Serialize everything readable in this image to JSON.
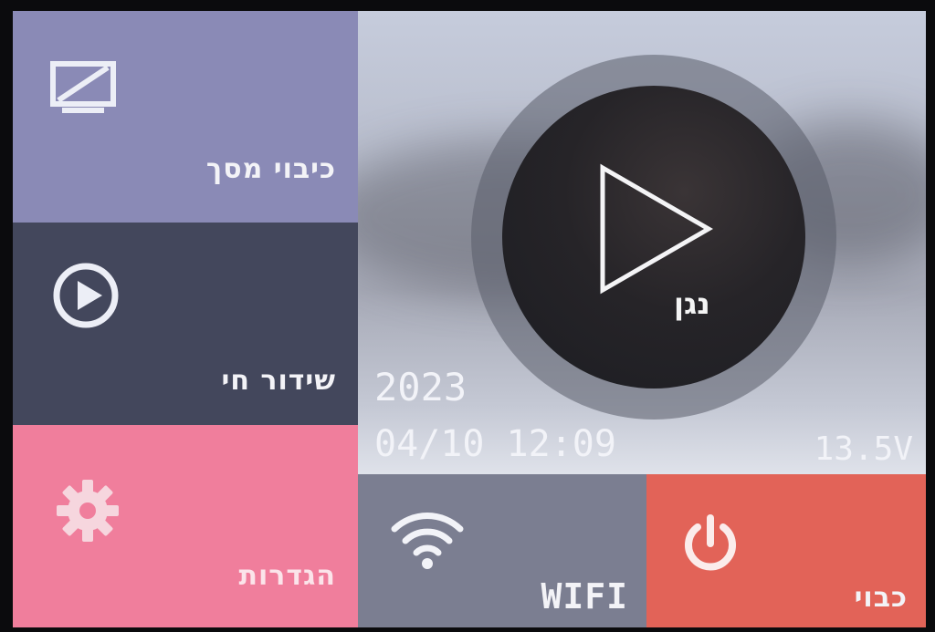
{
  "tiles": {
    "screen_off": {
      "label": "כיבוי מסך",
      "icon": "monitor-off-icon",
      "color": "#8a8ab6"
    },
    "live_stream": {
      "label": "שידור חי",
      "icon": "play-circle-icon",
      "color": "#43475c"
    },
    "settings": {
      "label": "הגדרות",
      "icon": "gear-icon",
      "color": "#f07e9c"
    },
    "player": {
      "label": "נגן",
      "icon": "play-icon"
    },
    "wifi": {
      "label": "WIFI",
      "icon": "wifi-icon",
      "color": "#7b7e91"
    },
    "power": {
      "label": "כבוי",
      "icon": "power-icon",
      "color": "#e26358"
    }
  },
  "status": {
    "year": "2023",
    "date_time": "04/10 12:09",
    "voltage": "13.5V"
  }
}
